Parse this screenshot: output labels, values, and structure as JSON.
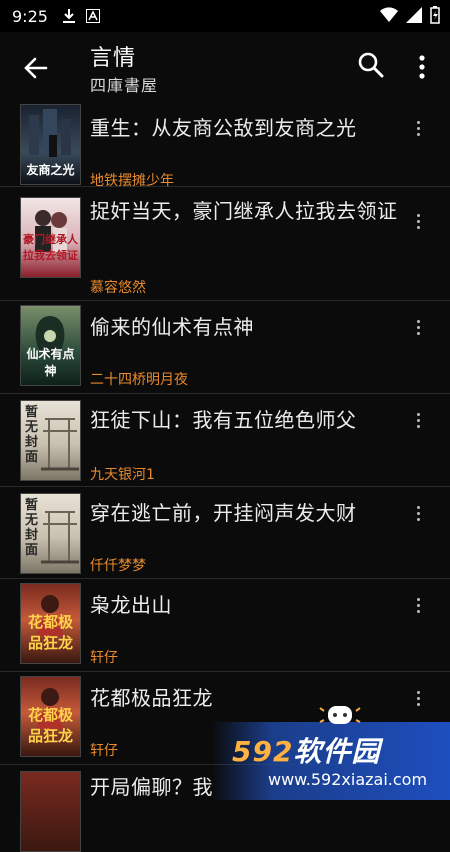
{
  "status_bar": {
    "time": "9:25"
  },
  "app_bar": {
    "title": "言情",
    "subtitle": "四庫書屋"
  },
  "books": [
    {
      "title": "重生：从友商公敌到友商之光",
      "author": "地铁摆摊少年",
      "cover_text": "友商之光"
    },
    {
      "title": "捉奸当天，豪门继承人拉我去领证",
      "author": "慕容悠然",
      "cover_text": "豪门继承人拉我去领证"
    },
    {
      "title": "偷来的仙术有点神",
      "author": "二十四桥明月夜",
      "cover_text": "仙术有点神"
    },
    {
      "title": "狂徒下山：我有五位绝色师父",
      "author": "九天银河1",
      "cover_text": "暂无封面"
    },
    {
      "title": "穿在逃亡前，开挂闷声发大财",
      "author": "仟仟梦梦",
      "cover_text": "暂无封面"
    },
    {
      "title": "枭龙出山",
      "author": "轩仔",
      "cover_text": "花都极品狂龙"
    },
    {
      "title": "花都极品狂龙",
      "author": "轩仔",
      "cover_text": "花都极品狂龙"
    },
    {
      "title": "开局偏聊？我"
    }
  ],
  "watermark": {
    "brand_num": "592",
    "brand_text": "软件园",
    "url": "www.592xiazai.com"
  }
}
